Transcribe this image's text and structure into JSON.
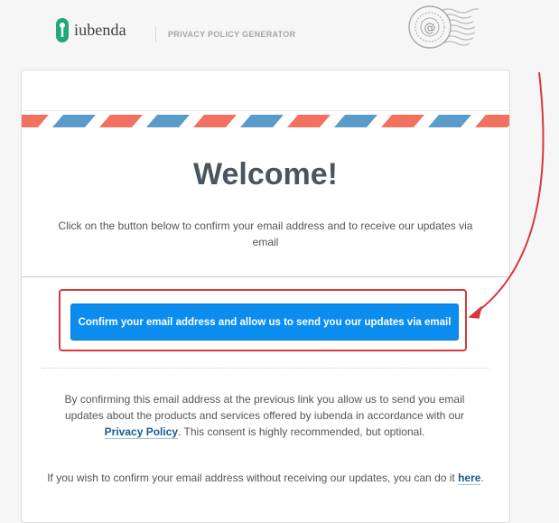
{
  "header": {
    "brand": "iubenda",
    "subtitle": "PRIVACY POLICY GENERATOR",
    "logo_icon": "keyhole-icon",
    "stamp_icon": "postmark-stamp-icon"
  },
  "email": {
    "title": "Welcome!",
    "intro": "Click on the button below to confirm your email address and to receive our updates via email",
    "confirm_button": "Confirm your email address and allow us to send you our updates via email",
    "consent_pre": "By confirming this email address at the previous link you allow us to send you email updates about the products and services offered by iubenda in accordance with our ",
    "privacy_link": "Privacy Policy",
    "consent_post": ". This consent is highly recommended, but optional.",
    "no_updates_pre": "If you wish to confirm your email address without receiving our updates, you can do it ",
    "here_link": "here",
    "no_updates_post": "."
  },
  "colors": {
    "brand_green": "#1fa87a",
    "button_blue": "#0b8df0",
    "link_blue": "#1a5a94",
    "annotation_red": "#d9393b",
    "airmail_red": "#f2715f",
    "airmail_blue": "#5a9bc9"
  }
}
